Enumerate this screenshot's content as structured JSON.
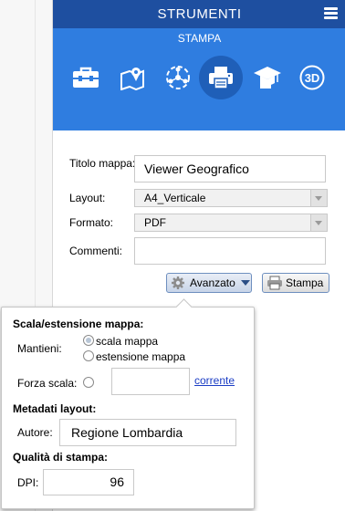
{
  "header": {
    "title": "STRUMENTI",
    "menu_icon": "menu-icon"
  },
  "toolbar": {
    "subtitle": "STAMPA",
    "tools": [
      {
        "name": "toolbox",
        "icon": "toolbox-icon"
      },
      {
        "name": "map-pin",
        "icon": "map-pin-icon"
      },
      {
        "name": "network",
        "icon": "network-icon"
      },
      {
        "name": "print",
        "icon": "printer-icon",
        "active": true
      },
      {
        "name": "education",
        "icon": "graduation-cap-icon"
      },
      {
        "name": "3d",
        "icon": "3d-icon",
        "label": "3D"
      }
    ]
  },
  "form": {
    "title_label": "Titolo mappa:",
    "title_value": "Viewer Geografico",
    "layout_label": "Layout:",
    "layout_value": "A4_Verticale",
    "format_label": "Formato:",
    "format_value": "PDF",
    "comments_label": "Commenti:",
    "comments_value": ""
  },
  "buttons": {
    "advanced": "Avanzato",
    "print": "Stampa"
  },
  "advanced": {
    "scale_section": "Scala/estensione mappa:",
    "keep_label": "Mantieni:",
    "opt_scale": "scala mappa",
    "opt_extent": "estensione mappa",
    "force_scale_label": "Forza scala:",
    "force_scale_value": "",
    "current_link": "corrente",
    "metadata_section": "Metadati layout:",
    "author_label": "Autore:",
    "author_value": "Regione Lombardia",
    "quality_section": "Qualità di stampa:",
    "dpi_label": "DPI:",
    "dpi_value": "96"
  },
  "colors": {
    "header": "#1e4fa0",
    "toolband": "#2f7de0",
    "active_tool": "#1f5fb8",
    "link": "#1a3cc4"
  }
}
